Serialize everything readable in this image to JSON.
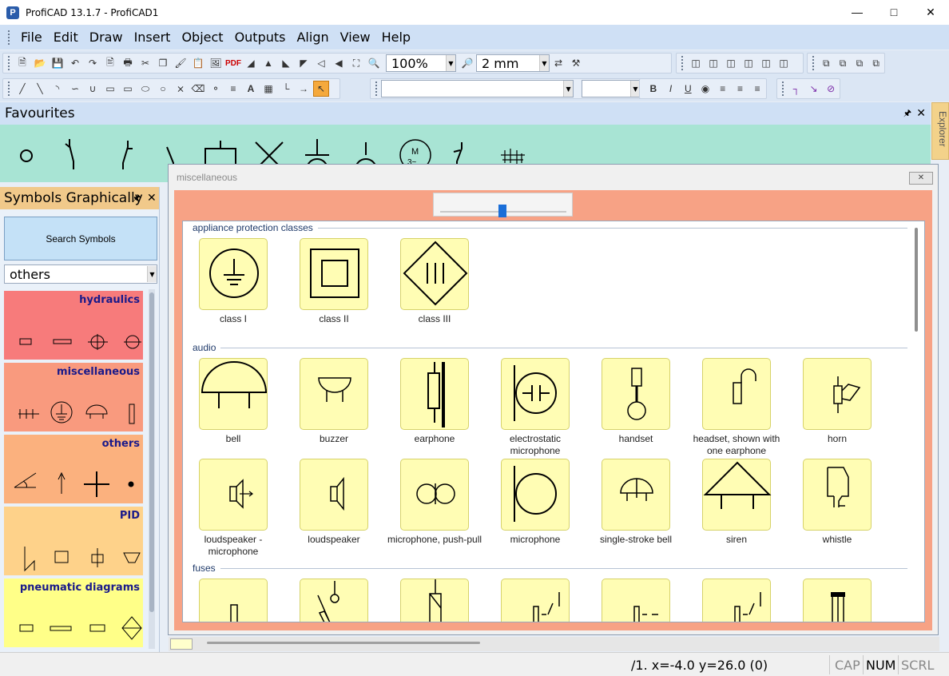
{
  "window": {
    "title": "ProfiCAD 13.1.7 - ProfiCAD1",
    "controls": [
      "minimize",
      "maximize",
      "close"
    ]
  },
  "menu": [
    "File",
    "Edit",
    "Draw",
    "Insert",
    "Object",
    "Outputs",
    "Align",
    "View",
    "Help"
  ],
  "toolbar": {
    "zoom_value": "100%",
    "grid_value": "2 mm",
    "font_value": "",
    "font_size_value": ""
  },
  "favourites": {
    "title": "Favourites",
    "explorer_tab": "Explorer"
  },
  "symbols_panel": {
    "title": "Symbols Graphically",
    "search_label": "Search Symbols",
    "category_value": "others",
    "libraries": [
      {
        "name": "hydraulics",
        "color": "#f77b7b"
      },
      {
        "name": "miscellaneous",
        "color": "#f99a7e"
      },
      {
        "name": "others",
        "color": "#fbb17e"
      },
      {
        "name": "PID",
        "color": "#fed28a"
      },
      {
        "name": "pneumatic diagrams",
        "color": "#ffff88"
      }
    ]
  },
  "document": {
    "title": "miscellaneous",
    "sections": [
      {
        "title": "appliance protection classes",
        "symbols": [
          "class I",
          "class II",
          "class III"
        ]
      },
      {
        "title": "audio",
        "symbols": [
          "bell",
          "buzzer",
          "earphone",
          "electrostatic microphone",
          "handset",
          "headset, shown with one earphone",
          "horn",
          "loudspeaker - microphone",
          "loudspeaker",
          "microphone, push-pull",
          "microphone",
          "single-stroke bell",
          "siren",
          "whistle"
        ]
      },
      {
        "title": "fuses",
        "symbols": []
      }
    ]
  },
  "status": {
    "coords": "/1.  x=-4.0  y=26.0 (0)",
    "cap": "CAP",
    "num": "NUM",
    "scrl": "SCRL"
  },
  "colors": {
    "favourites_bg": "#a8e4d4",
    "symbol_tile": "#fffdb4",
    "doc_frame": "#f7a285"
  }
}
